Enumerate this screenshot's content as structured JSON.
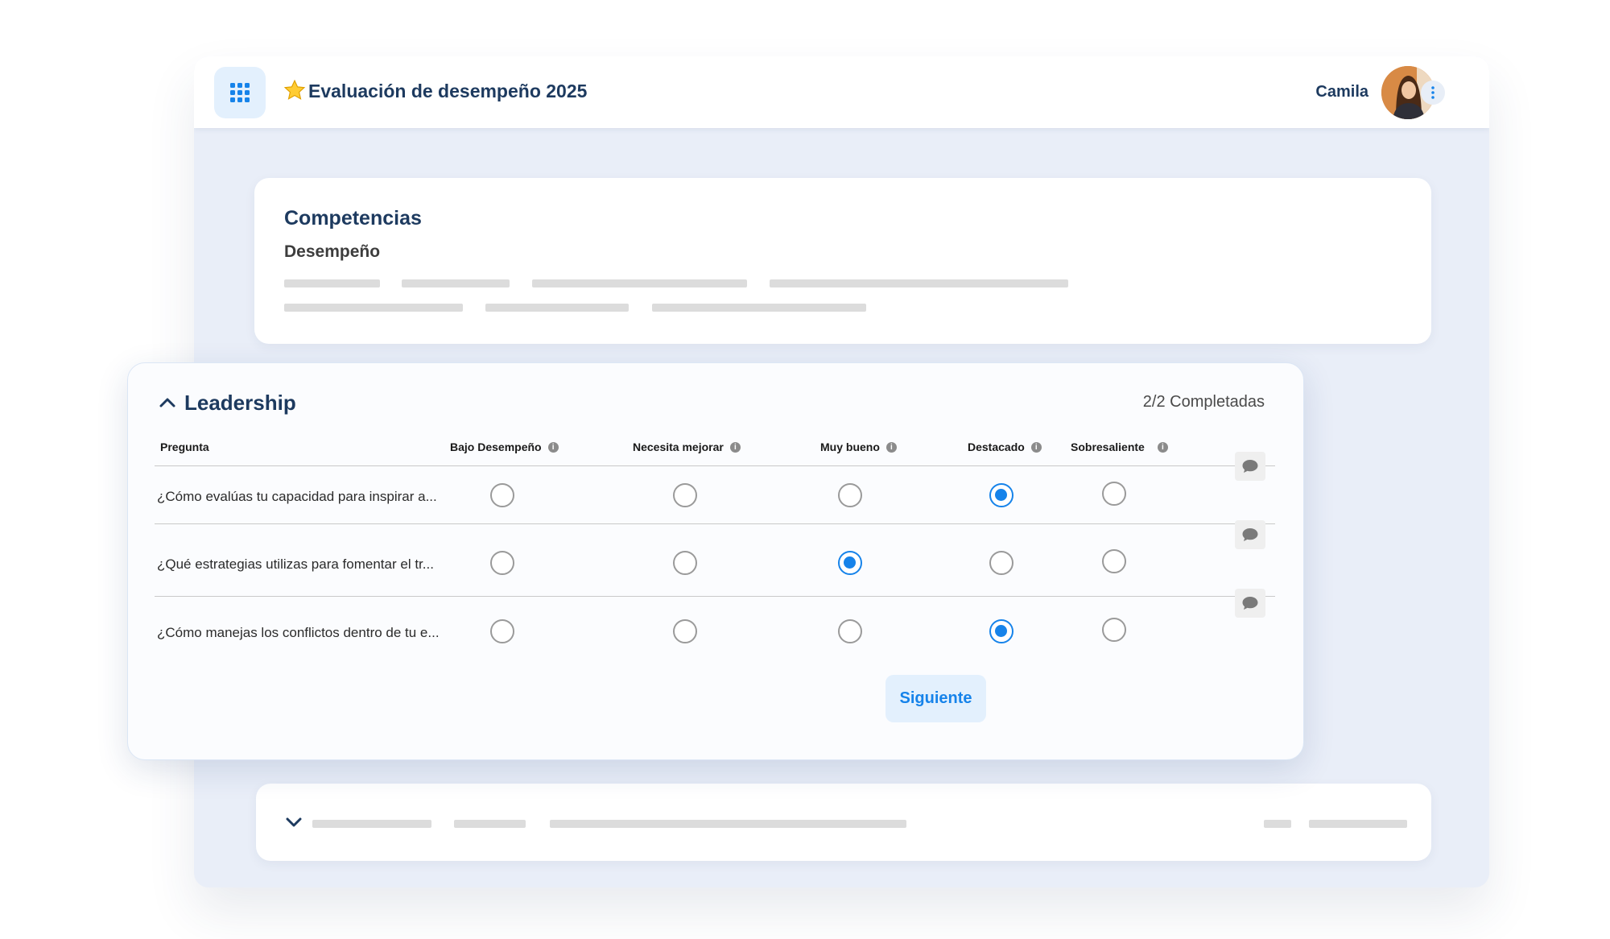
{
  "app": {
    "title": "Evaluación de desempeño 2025",
    "user_name": "Camila"
  },
  "icons": {
    "apps": "apps-grid-icon",
    "title_star": "star-icon",
    "user_menu": "kebab-menu-icon",
    "section_toggle": "chevron-up-icon",
    "collapsed_toggle": "chevron-down-icon",
    "comment": "comment-icon",
    "info": "info-icon"
  },
  "competencias": {
    "title": "Competencias",
    "subtitle": "Desempeño"
  },
  "leadership": {
    "title": "Leadership",
    "progress": "2/2 Completadas",
    "question_header": "Pregunta",
    "options": [
      "Bajo Desempeño",
      "Necesita mejorar",
      "Muy bueno",
      "Destacado",
      "Sobresaliente"
    ],
    "questions": [
      {
        "text": "¿Cómo evalúas tu capacidad para inspirar a...",
        "selected": "Destacado"
      },
      {
        "text": "¿Qué estrategias utilizas para fomentar el tr...",
        "selected": "Muy bueno"
      },
      {
        "text": "¿Cómo manejas los conflictos dentro de tu e...",
        "selected": "Destacado"
      }
    ],
    "next_label": "Siguiente"
  },
  "colors": {
    "accent": "#1683ea",
    "title_text": "#1d3a5f",
    "accent_light": "#e3f0fd",
    "background": "#e9eef8"
  }
}
